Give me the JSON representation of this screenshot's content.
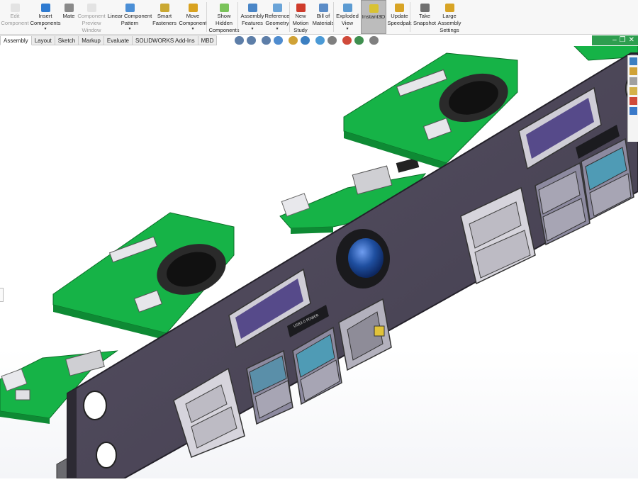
{
  "ribbon": {
    "buttons": [
      {
        "id": "edit-component",
        "lines": [
          "Edit",
          "Component"
        ],
        "disabled": true,
        "icon": "edit-component-icon"
      },
      {
        "id": "insert-components",
        "lines": [
          "Insert",
          "Components"
        ],
        "dropdown": true,
        "icon": "insert-components-icon"
      },
      {
        "id": "mate",
        "lines": [
          "Mate"
        ],
        "icon": "paperclip-icon"
      },
      {
        "id": "component-preview-window",
        "lines": [
          "Component",
          "Preview",
          "Window"
        ],
        "disabled": true,
        "icon": "preview-window-icon"
      },
      {
        "id": "linear-component-pattern",
        "lines": [
          "Linear Component",
          "Pattern"
        ],
        "dropdown": true,
        "icon": "linear-pattern-icon"
      },
      {
        "id": "smart-fasteners",
        "lines": [
          "Smart",
          "Fasteners"
        ],
        "icon": "smart-fasteners-icon"
      },
      {
        "id": "move-component",
        "lines": [
          "Move",
          "Component"
        ],
        "dropdown": true,
        "icon": "move-component-icon"
      },
      {
        "id": "show-hidden-components",
        "lines": [
          "Show",
          "Hidden",
          "Components"
        ],
        "icon": "show-hidden-icon"
      },
      {
        "id": "assembly-features",
        "lines": [
          "Assembly",
          "Features"
        ],
        "dropdown": true,
        "icon": "assembly-features-icon"
      },
      {
        "id": "reference-geometry",
        "lines": [
          "Reference",
          "Geometry"
        ],
        "dropdown": true,
        "icon": "reference-geometry-icon"
      },
      {
        "id": "new-motion-study",
        "lines": [
          "New",
          "Motion",
          "Study"
        ],
        "icon": "motion-study-icon"
      },
      {
        "id": "bill-of-materials",
        "lines": [
          "Bill of",
          "Materials"
        ],
        "icon": "bill-of-materials-icon"
      },
      {
        "id": "exploded-view",
        "lines": [
          "Exploded",
          "View"
        ],
        "dropdown": true,
        "icon": "exploded-view-icon"
      },
      {
        "id": "instant3d",
        "lines": [
          "Instant3D"
        ],
        "active": true,
        "icon": "instant3d-icon"
      },
      {
        "id": "update-speedpak",
        "lines": [
          "Update",
          "Speedpak"
        ],
        "icon": "speedpak-icon"
      },
      {
        "id": "take-snapshot",
        "lines": [
          "Take",
          "Snapshot"
        ],
        "icon": "camera-icon"
      },
      {
        "id": "large-assembly-settings",
        "lines": [
          "Large",
          "Assembly",
          "Settings"
        ],
        "icon": "large-assembly-icon"
      }
    ]
  },
  "tabs": [
    "Assembly",
    "Layout",
    "Sketch",
    "Markup",
    "Evaluate",
    "SOLIDWORKS Add-Ins",
    "MBD"
  ],
  "active_tab": "Assembly",
  "heads_up_toolbar": [
    "zoom-to-fit-icon",
    "zoom-to-area-icon",
    "previous-view-icon",
    "section-view-icon",
    "dynamic-annotation-icon",
    "view-orientation-icon",
    "display-style-icon",
    "hide-show-items-icon",
    "edit-appearance-icon",
    "apply-scene-icon",
    "view-settings-icon"
  ],
  "task_pane": [
    "solidworks-resources-icon",
    "design-library-icon",
    "file-explorer-icon",
    "view-palette-icon",
    "appearances-icon",
    "custom-properties-icon"
  ],
  "panel": {
    "ports": {
      "usb_label": "USB3.0 POWER"
    }
  },
  "colors": {
    "pcb": "#14b845",
    "pcb_dark": "#0c7a2c",
    "panel": "#4a4556",
    "panel_edge": "#2c2a33",
    "oled": "#574a8c",
    "button": "#1f4fa0",
    "active_button": "#bcbcbc"
  }
}
